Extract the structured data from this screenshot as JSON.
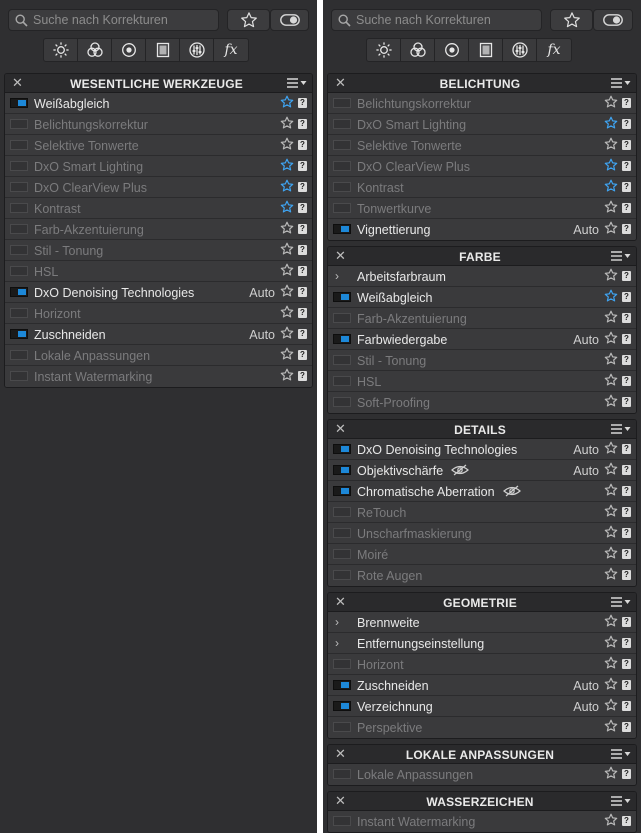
{
  "search": {
    "placeholder": "Suche nach Korrekturen"
  },
  "tool_icons": [
    "sun-icon",
    "color-circles-icon",
    "lens-icon",
    "frame-icon",
    "sliders-icon",
    "fx-icon"
  ],
  "fx_label": "fx",
  "colors": {
    "panel_bg": "#2f2f31",
    "row_bg": "#3a3a3c",
    "accent_blue": "#1d88d8",
    "star_blue": "#3fa3f0",
    "text_active": "#e8e8e8",
    "text_inactive": "#7b7b7d"
  },
  "left_panel": {
    "sections": [
      {
        "title": "WESENTLICHE WERKZEUGE",
        "rows": [
          {
            "label": "Weißabgleich",
            "state": "on",
            "star": "blue"
          },
          {
            "label": "Belichtungskorrektur",
            "state": "off",
            "star": "gray"
          },
          {
            "label": "Selektive Tonwerte",
            "state": "off",
            "star": "gray"
          },
          {
            "label": "DxO Smart Lighting",
            "state": "off",
            "star": "blue"
          },
          {
            "label": "DxO ClearView Plus",
            "state": "off",
            "star": "blue"
          },
          {
            "label": "Kontrast",
            "state": "off",
            "star": "blue"
          },
          {
            "label": "Farb-Akzentuierung",
            "state": "off",
            "star": "gray"
          },
          {
            "label": "Stil - Tonung",
            "state": "off",
            "star": "gray"
          },
          {
            "label": "HSL",
            "state": "off",
            "star": "gray"
          },
          {
            "label": "DxO Denoising Technologies",
            "state": "on",
            "star": "gray",
            "auto": "Auto"
          },
          {
            "label": "Horizont",
            "state": "off",
            "star": "gray"
          },
          {
            "label": "Zuschneiden",
            "state": "on",
            "star": "gray",
            "auto": "Auto"
          },
          {
            "label": "Lokale Anpassungen",
            "state": "off",
            "star": "gray"
          },
          {
            "label": "Instant Watermarking",
            "state": "off",
            "star": "gray"
          }
        ]
      }
    ]
  },
  "right_panel": {
    "sections": [
      {
        "title": "BELICHTUNG",
        "rows": [
          {
            "label": "Belichtungskorrektur",
            "state": "off",
            "star": "gray"
          },
          {
            "label": "DxO Smart Lighting",
            "state": "off",
            "star": "blue"
          },
          {
            "label": "Selektive Tonwerte",
            "state": "off",
            "star": "gray"
          },
          {
            "label": "DxO ClearView Plus",
            "state": "off",
            "star": "blue"
          },
          {
            "label": "Kontrast",
            "state": "off",
            "star": "blue"
          },
          {
            "label": "Tonwertkurve",
            "state": "off",
            "star": "gray"
          },
          {
            "label": "Vignettierung",
            "state": "on",
            "star": "gray",
            "auto": "Auto"
          }
        ]
      },
      {
        "title": "FARBE",
        "rows": [
          {
            "label": "Arbeitsfarbraum",
            "state": "chevron",
            "star": "gray"
          },
          {
            "label": "Weißabgleich",
            "state": "on",
            "star": "blue"
          },
          {
            "label": "Farb-Akzentuierung",
            "state": "off",
            "star": "gray"
          },
          {
            "label": "Farbwiedergabe",
            "state": "on",
            "star": "gray",
            "auto": "Auto"
          },
          {
            "label": "Stil - Tonung",
            "state": "off",
            "star": "gray"
          },
          {
            "label": "HSL",
            "state": "off",
            "star": "gray"
          },
          {
            "label": "Soft-Proofing",
            "state": "off",
            "star": "gray"
          }
        ]
      },
      {
        "title": "DETAILS",
        "rows": [
          {
            "label": "DxO Denoising Technologies",
            "state": "on",
            "star": "gray",
            "auto": "Auto"
          },
          {
            "label": "Objektivschärfe",
            "state": "on",
            "star": "gray",
            "auto": "Auto",
            "eye": true
          },
          {
            "label": "Chromatische Aberration",
            "state": "on",
            "star": "gray",
            "eye": true
          },
          {
            "label": "ReTouch",
            "state": "off",
            "star": "gray"
          },
          {
            "label": "Unscharfmaskierung",
            "state": "off",
            "star": "gray"
          },
          {
            "label": "Moiré",
            "state": "off",
            "star": "gray"
          },
          {
            "label": "Rote Augen",
            "state": "off",
            "star": "gray"
          }
        ]
      },
      {
        "title": "GEOMETRIE",
        "rows": [
          {
            "label": "Brennweite",
            "state": "chevron",
            "star": "gray"
          },
          {
            "label": "Entfernungseinstellung",
            "state": "chevron",
            "star": "gray"
          },
          {
            "label": "Horizont",
            "state": "off",
            "star": "gray"
          },
          {
            "label": "Zuschneiden",
            "state": "on",
            "star": "gray",
            "auto": "Auto"
          },
          {
            "label": "Verzeichnung",
            "state": "on",
            "star": "gray",
            "auto": "Auto"
          },
          {
            "label": "Perspektive",
            "state": "off",
            "star": "gray"
          }
        ]
      },
      {
        "title": "LOKALE ANPASSUNGEN",
        "rows": [
          {
            "label": "Lokale Anpassungen",
            "state": "off",
            "star": "gray"
          }
        ]
      },
      {
        "title": "WASSERZEICHEN",
        "rows": [
          {
            "label": "Instant Watermarking",
            "state": "off",
            "star": "gray"
          }
        ]
      }
    ]
  }
}
